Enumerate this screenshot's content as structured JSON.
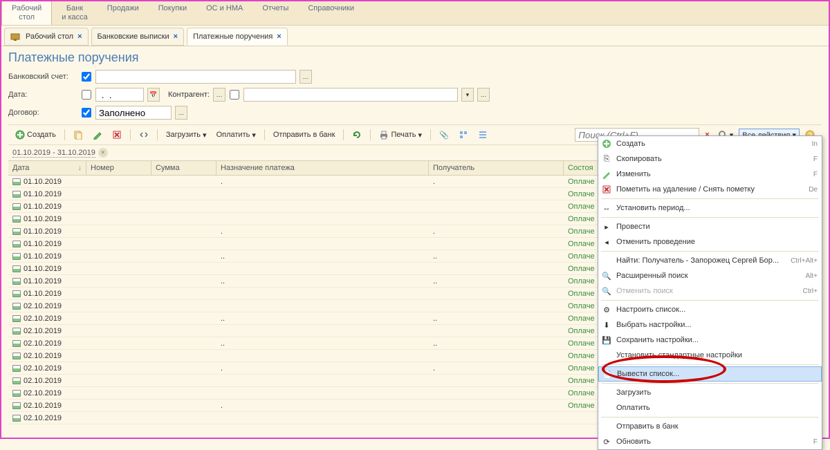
{
  "mainMenu": [
    "Рабочий стол",
    "Банк и касса",
    "Продажи",
    "Покупки",
    "ОС и НМА",
    "Отчеты",
    "Справочники"
  ],
  "tabs": [
    {
      "label": "Рабочий стол",
      "active": false
    },
    {
      "label": "Банковские выписки",
      "active": false
    },
    {
      "label": "Платежные поручения",
      "active": true
    }
  ],
  "pageTitle": "Платежные поручения",
  "filters": {
    "bankAccount": {
      "label": "Банковский счет:",
      "checked": true,
      "value": ""
    },
    "date": {
      "label": "Дата:",
      "checked": false,
      "value": " .  . "
    },
    "counterparty": {
      "label": "Контрагент:",
      "checked": false,
      "value": ""
    },
    "contract": {
      "label": "Договор:",
      "checked": true,
      "value": "Заполнено"
    }
  },
  "toolbar": {
    "create": "Создать",
    "load": "Загрузить",
    "pay": "Оплатить",
    "send": "Отправить в банк",
    "print": "Печать",
    "allActions": "Все действия",
    "searchPlaceholder": "Поиск (Ctrl+F)"
  },
  "period": "01.10.2019 - 31.10.2019",
  "columns": {
    "date": "Дата",
    "number": "Номер",
    "sum": "Сумма",
    "purpose": "Назначение платежа",
    "recipient": "Получатель",
    "status": "Состоя"
  },
  "rows": [
    {
      "date": "01.10.2019",
      "purpose": ".",
      "recipient": ".",
      "status": "Оплаче"
    },
    {
      "date": "01.10.2019",
      "purpose": "",
      "recipient": "",
      "status": "Оплаче"
    },
    {
      "date": "01.10.2019",
      "purpose": "",
      "recipient": "",
      "status": "Оплаче"
    },
    {
      "date": "01.10.2019",
      "purpose": "",
      "recipient": "",
      "status": "Оплаче"
    },
    {
      "date": "01.10.2019",
      "purpose": ".",
      "recipient": ".",
      "status": "Оплаче"
    },
    {
      "date": "01.10.2019",
      "purpose": "",
      "recipient": "",
      "status": "Оплаче"
    },
    {
      "date": "01.10.2019",
      "purpose": "..",
      "recipient": "..",
      "status": "Оплаче"
    },
    {
      "date": "01.10.2019",
      "purpose": "",
      "recipient": "",
      "status": "Оплаче"
    },
    {
      "date": "01.10.2019",
      "purpose": "..",
      "recipient": "..",
      "status": "Оплаче"
    },
    {
      "date": "01.10.2019",
      "purpose": "",
      "recipient": "",
      "status": "Оплаче"
    },
    {
      "date": "02.10.2019",
      "purpose": "",
      "recipient": "",
      "status": "Оплаче"
    },
    {
      "date": "02.10.2019",
      "purpose": "..",
      "recipient": "..",
      "status": "Оплаче"
    },
    {
      "date": "02.10.2019",
      "purpose": "",
      "recipient": "",
      "status": "Оплаче"
    },
    {
      "date": "02.10.2019",
      "purpose": "..",
      "recipient": "..",
      "status": "Оплаче"
    },
    {
      "date": "02.10.2019",
      "purpose": "",
      "recipient": "",
      "status": "Оплаче"
    },
    {
      "date": "02.10.2019",
      "purpose": ".",
      "recipient": ".",
      "status": "Оплаче"
    },
    {
      "date": "02.10.2019",
      "purpose": "",
      "recipient": "",
      "status": "Оплаче"
    },
    {
      "date": "02.10.2019",
      "purpose": "",
      "recipient": "",
      "status": "Оплаче"
    },
    {
      "date": "02.10.2019",
      "purpose": ".",
      "recipient": "",
      "status": "Оплаче"
    },
    {
      "date": "02.10.2019",
      "purpose": "",
      "recipient": "",
      "status": ""
    }
  ],
  "contextMenu": [
    {
      "icon": "plus",
      "label": "Создать",
      "shortcut": "In"
    },
    {
      "icon": "copy",
      "label": "Скопировать",
      "shortcut": "F"
    },
    {
      "icon": "pencil",
      "label": "Изменить",
      "shortcut": "F"
    },
    {
      "icon": "del",
      "label": "Пометить на удаление / Снять пометку",
      "shortcut": "De"
    },
    {
      "sep": true
    },
    {
      "icon": "period",
      "label": "Установить период..."
    },
    {
      "sep": true
    },
    {
      "icon": "post",
      "label": "Провести"
    },
    {
      "icon": "unpost",
      "label": "Отменить проведение"
    },
    {
      "sep": true
    },
    {
      "icon": "find",
      "label": "Найти: Получатель - Запорожец Сергей Бор...",
      "shortcut": "Ctrl+Alt+"
    },
    {
      "icon": "search",
      "label": "Расширенный поиск",
      "shortcut": "Alt+"
    },
    {
      "icon": "cancelsearch",
      "label": "Отменить поиск",
      "shortcut": "Ctrl+",
      "disabled": true
    },
    {
      "sep": true
    },
    {
      "icon": "cfg",
      "label": "Настроить список..."
    },
    {
      "icon": "load-cfg",
      "label": "Выбрать настройки..."
    },
    {
      "icon": "save-cfg",
      "label": "Сохранить настройки..."
    },
    {
      "icon": "",
      "label": "Установить стандартные настройки"
    },
    {
      "sep": true
    },
    {
      "icon": "export",
      "label": "Вывести список...",
      "hl": true
    },
    {
      "sep": true
    },
    {
      "icon": "",
      "label": "Загрузить"
    },
    {
      "icon": "",
      "label": "Оплатить"
    },
    {
      "sep": true
    },
    {
      "icon": "",
      "label": "Отправить в банк"
    },
    {
      "icon": "refresh",
      "label": "Обновить",
      "shortcut": "F"
    }
  ]
}
